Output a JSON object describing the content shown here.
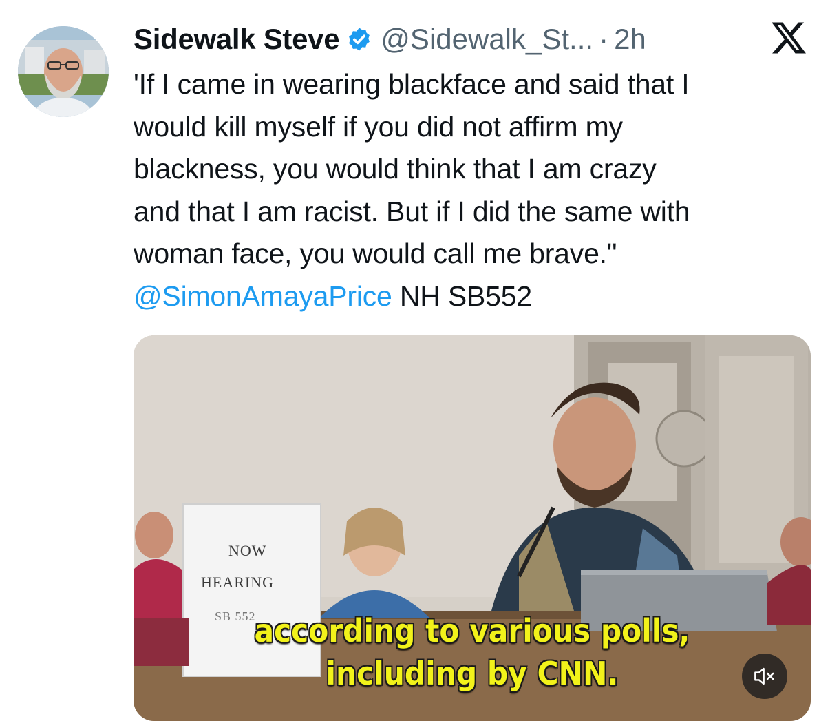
{
  "author": {
    "display_name": "Sidewalk Steve",
    "handle": "@Sidewalk_St...",
    "separator": "·",
    "time": "2h",
    "verified": true
  },
  "tweet": {
    "lines": [
      "'If I came in wearing blackface and said that I",
      "would kill myself if you did not affirm my",
      "blackness, you would think that I am crazy",
      "and that I am racist. But if I did the same with",
      "woman face, you would call me brave.\""
    ],
    "mention": "@SimonAmayaPrice",
    "tag_text": " NH SB552"
  },
  "media": {
    "sign": {
      "line1": "NOW",
      "line2": "HEARING",
      "line3": "SB 552"
    },
    "caption": {
      "line1": "according to various polls,",
      "line2": "including by CNN."
    },
    "mute_icon": "speaker-muted-icon"
  },
  "icons": {
    "verified": "verified-badge-icon",
    "platform": "x-logo-icon"
  },
  "colors": {
    "text_primary": "#0f1419",
    "text_secondary": "#536471",
    "link": "#1d9bf0",
    "verified": "#1d9bf0",
    "caption": "#f2f21a"
  }
}
